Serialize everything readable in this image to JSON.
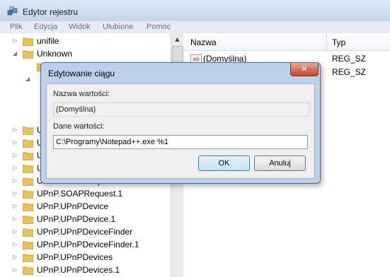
{
  "window": {
    "title": "Edytor rejestru"
  },
  "menu": [
    "Plik",
    "Edycja",
    "Widok",
    "Ulubione",
    "Pomoc"
  ],
  "tree": {
    "items": [
      {
        "label": "unifile"
      },
      {
        "label": "Unknown"
      },
      {
        "label": ""
      },
      {
        "label": ""
      },
      {
        "label": "U"
      },
      {
        "label": "U"
      },
      {
        "label": "U"
      },
      {
        "label": "U"
      },
      {
        "label": "UPnP.SOAPRequest"
      },
      {
        "label": "UPnP.SOAPRequest.1"
      },
      {
        "label": "UPnP.UPnPDevice"
      },
      {
        "label": "UPnP.UPnPDevice.1"
      },
      {
        "label": "UPnP.UPnPDeviceFinder"
      },
      {
        "label": "UPnP.UPnPDeviceFinder.1"
      },
      {
        "label": "UPnP.UPnPDevices"
      },
      {
        "label": "UPnP.UPnPDevices.1"
      }
    ]
  },
  "list": {
    "columns": [
      "Nazwa",
      "Typ"
    ],
    "rows": [
      {
        "name": "(Domyślna)",
        "type": "REG_SZ",
        "icon": "ab-string-icon"
      },
      {
        "name": "",
        "type": "REG_SZ",
        "icon": ""
      }
    ]
  },
  "dialog": {
    "title": "Edytowanie ciągu",
    "name_label": "Nazwa wartości:",
    "name_value": "(Domyślna)",
    "data_label": "Dane wartości:",
    "data_value": "C:\\Programy\\Notepad++.exe %1",
    "ok_label": "OK",
    "cancel_label": "Anuluj",
    "close_glyph": "✕"
  },
  "colors": {
    "accent": "#3c7fb1",
    "close": "#c4452c",
    "folder": "#e8c25a"
  }
}
